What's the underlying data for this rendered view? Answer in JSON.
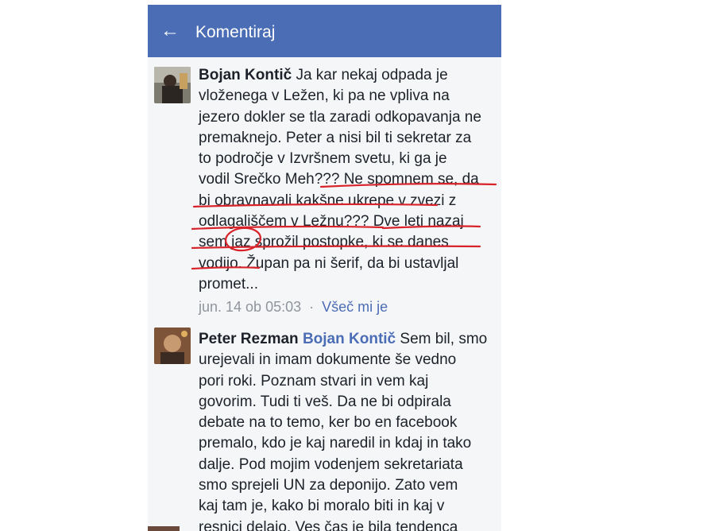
{
  "appbar": {
    "back_icon": "arrow-left-icon",
    "title": "Komentiraj",
    "color": "#4b6db6"
  },
  "comments": [
    {
      "author": "Bojan Kontič",
      "avatar_icon": "user-avatar-photo",
      "lines": [
        "Ja kar nekaj odpada je",
        "vloženega v Ležen, ki pa ne vpliva na",
        "jezero dokler se tla zaradi odkopavanja ne",
        "premaknejo. Peter a nisi bil ti sekretar za",
        "to področje v Izvršnem svetu, ki ga je",
        "vodil Srečko Meh??? Ne spomnem se, da",
        "bi obravnavali kakšne ukrepe v zvezi z",
        "odlagališčem v Ležnu??? Dve leti nazaj",
        "sem jaz sprožil postopke, ki se danes",
        "vodijo. Župan pa ni šerif, da bi ustavljal",
        "promet..."
      ],
      "time": "jun. 14 ob 05:03",
      "like_label": "Všeč mi je"
    },
    {
      "author": "Peter Rezman",
      "mention": "Bojan Kontič",
      "avatar_icon": "user-avatar-photo",
      "lines": [
        "Sem bil, smo",
        "urejevali in imam dokumente še vedno",
        "pori roki. Poznam stvari in vem kaj",
        "govorim. Tudi ti veš. Da ne bi odpirala",
        "debate na to temo, ker bo en facebook",
        "premalo, kdo je kaj naredil in kdaj in tako",
        "dalje. Pod mojim vodenjem sekretariata",
        "smo sprejeli UN za deponijo. Zato vem",
        "kaj tam je, kako bi moralo biti in kaj v",
        "resnici delajo. Ves čas je bila tendenca"
      ]
    }
  ]
}
